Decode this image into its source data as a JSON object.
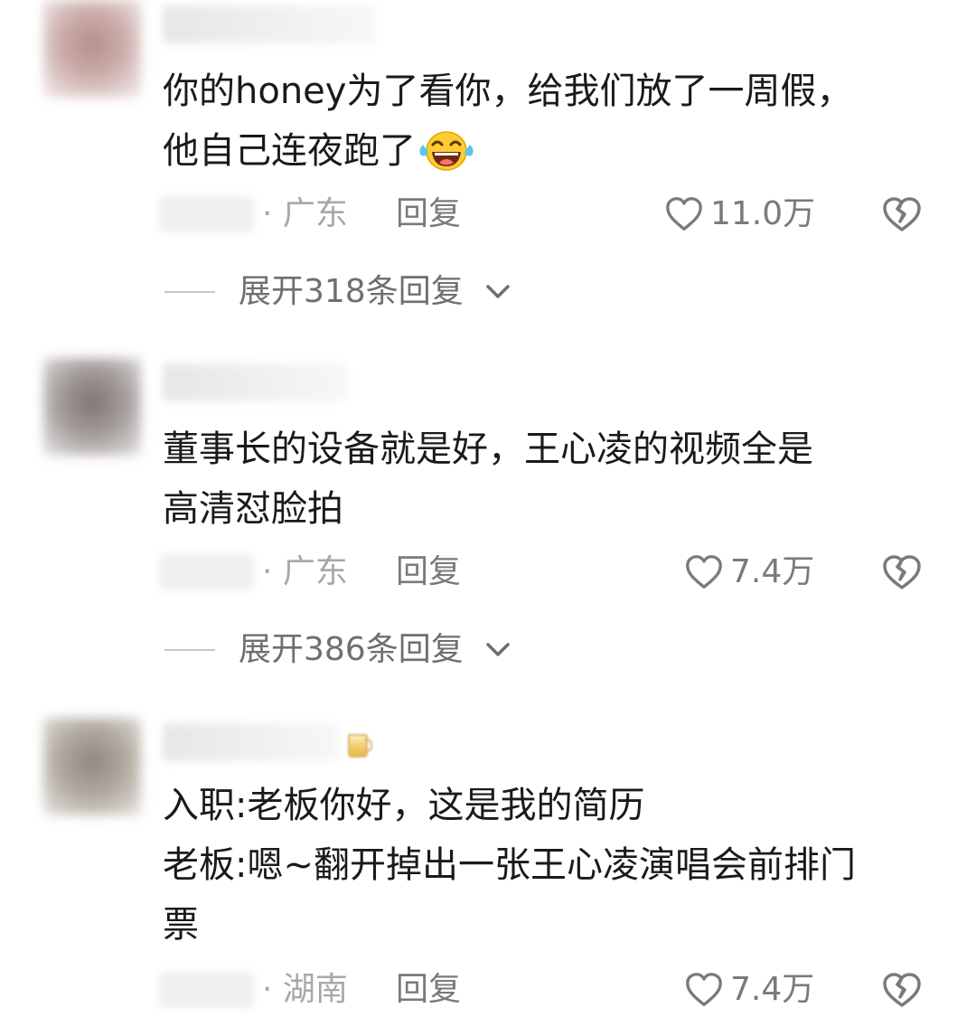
{
  "comments": [
    {
      "text_lines": [
        "你的honey为了看你，给我们放了一周假，",
        "他自己连夜跑了"
      ],
      "emoji": "laughing-crying-emoji",
      "region": "· 广东",
      "reply_label": "回复",
      "like_count": "11.0万",
      "expand_label": "展开318条回复"
    },
    {
      "text_lines": [
        "董事长的设备就是好，王心凌的视频全是",
        "高清怼脸拍"
      ],
      "region": "· 广东",
      "reply_label": "回复",
      "like_count": "7.4万",
      "expand_label": "展开386条回复"
    },
    {
      "text_lines": [
        "入职:老板你好，这是我的简历",
        "老板:嗯~翻开掉出一张王心凌演唱会前排门",
        "票"
      ],
      "badge": "beer-mug-icon",
      "region": "· 湖南",
      "reply_label": "回复",
      "like_count": "7.4万"
    }
  ],
  "colors": {
    "text": "#1a1a1a",
    "meta": "#7a7a7a",
    "region": "#a8a8a8",
    "rule": "#c6c6c6"
  },
  "icons": [
    "heart-outline-icon",
    "broken-heart-icon",
    "chevron-down-icon"
  ]
}
